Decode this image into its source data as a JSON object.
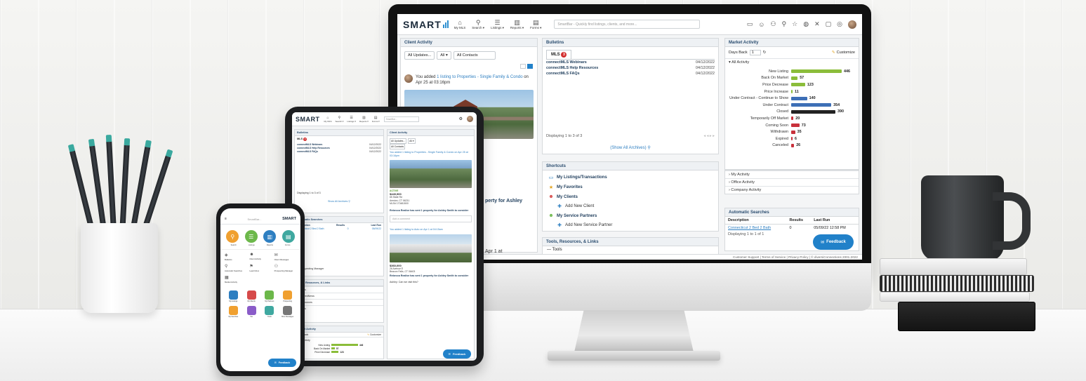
{
  "colors": {
    "accent": "#2181c9",
    "bar_green": "#8bbd3a",
    "bar_blue": "#3d6fb6",
    "bar_dark": "#222222",
    "bar_red": "#c8313b",
    "badge_red": "#d22e2e"
  },
  "desktop": {
    "logo": "SMART",
    "nav": [
      {
        "icon": "home-icon",
        "glyph": "⌂",
        "label": "My MLS"
      },
      {
        "icon": "search-icon",
        "glyph": "⚲",
        "label": "Search ▾"
      },
      {
        "icon": "listings-icon",
        "glyph": "☰",
        "label": "Listings ▾"
      },
      {
        "icon": "reports-icon",
        "glyph": "▥",
        "label": "Reports ▾"
      },
      {
        "icon": "forms-icon",
        "glyph": "▤",
        "label": "Forms ▾"
      }
    ],
    "smartbar_placeholder": "SmartBar - Quickly find listings, clients, and more...",
    "tool_icons": [
      "folder-icon",
      "contact-icon",
      "user-icon",
      "zoom-icon",
      "star-icon",
      "globe-icon",
      "settings-icon",
      "chat-icon",
      "help-icon"
    ],
    "client_activity": {
      "title": "Client Activity",
      "filter_updates": "All Updates...",
      "filter_all": "All ▾",
      "filter_contacts": "All Contacts",
      "activity_prefix": "You added ",
      "activity_link": "1 listing to Properties - Single Family & Condo",
      "activity_suffix": " on Apr 25 at 03:16pm",
      "partial_text_1": "perty for Ashley",
      "partial_text_2": "Apr 1 at"
    },
    "bulletins": {
      "title": "Bulletins",
      "tab_label": "MLS",
      "badge": "3",
      "items": [
        {
          "title": "connectMLS Webinars",
          "date": "04/12/2022"
        },
        {
          "title": "connectMLS Help Resources",
          "date": "04/12/2022"
        },
        {
          "title": "connectMLS FAQs",
          "date": "04/12/2022"
        }
      ],
      "displaying": "Displaying 1 to 3 of 3",
      "show_all": "(Show All Archives)"
    },
    "shortcuts": {
      "title": "Shortcuts",
      "items": [
        {
          "icon": "listings-folder-icon",
          "glyph": "▭",
          "label": "My Listings/Transactions",
          "sub": false
        },
        {
          "icon": "star-icon",
          "glyph": "★",
          "label": "My Favorites",
          "sub": false
        },
        {
          "icon": "clients-icon",
          "glyph": "☻",
          "label": "My Clients",
          "sub": false
        },
        {
          "icon": "plus-icon",
          "glyph": "✚",
          "label": "Add New Client",
          "sub": true
        },
        {
          "icon": "partners-icon",
          "glyph": "☻",
          "label": "My Service Partners",
          "sub": false
        },
        {
          "icon": "plus-icon",
          "glyph": "✚",
          "label": "Add New Service Partner",
          "sub": true
        }
      ]
    },
    "tools_panel": {
      "title": "Tools, Resources, & Links",
      "first_item": "Tools"
    },
    "market_activity": {
      "title": "Market Activity",
      "days_back_label": "Days Back",
      "days_back_value": "1",
      "customize": "Customize",
      "all_activity": "All Activity",
      "collapsed": [
        "My Activity",
        "Office Activity",
        "Company Activity"
      ]
    },
    "chart_data": {
      "type": "bar",
      "orientation": "horizontal",
      "categories": [
        "New Listing",
        "Back On Market",
        "Price Decrease",
        "Price Increase",
        "Under Contract - Continue to Show",
        "Under Contract",
        "Closed",
        "Temporarily Off Market",
        "Coming Soon",
        "Withdrawn",
        "Expired",
        "Canceled"
      ],
      "values": [
        446,
        57,
        123,
        11,
        140,
        354,
        390,
        20,
        73,
        35,
        6,
        26
      ],
      "colors": [
        "#8bbd3a",
        "#8bbd3a",
        "#8bbd3a",
        "#8bbd3a",
        "#3d6fb6",
        "#3d6fb6",
        "#222222",
        "#c8313b",
        "#c8313b",
        "#c8313b",
        "#c8313b",
        "#c8313b"
      ],
      "xlim": [
        0,
        446
      ],
      "grid": false,
      "legend": "none"
    },
    "automatic_searches": {
      "title": "Automatic Searches",
      "columns": [
        "Description",
        "Results",
        "Last Run"
      ],
      "rows": [
        [
          "Connecticut 2 Bed 2 Bath",
          "0",
          "05/09/22 12:58 PM"
        ]
      ],
      "displaying": "Displaying 1 to 1 of 1"
    },
    "feedback": "Feedback",
    "footer": "Customer Support | Terms of Service | Privacy Policy | © diversiConnections 2001-2022"
  },
  "tablet": {
    "logo": "SMART",
    "search_placeholder": "SmartBar...",
    "bulletins_title": "Bulletins",
    "bulletins_tab": "MLS",
    "bulletin_items": [
      {
        "title": "connectMLS Webinars",
        "date": "04/12/2022"
      },
      {
        "title": "connectMLS Help Resources",
        "date": "04/12/2022"
      },
      {
        "title": "connectMLS FAQs",
        "date": "04/12/2022"
      }
    ],
    "bulletins_displaying": "Displaying 1 to 3 of 3",
    "show_all": "Show All Archives",
    "auto_searches_title": "Automatic Searches",
    "prospecting_manager": "Prospecting Manager",
    "tools_title": "Tools, Resources, & Links",
    "tools_items": [
      "Tools",
      "MyFeedNews",
      "Resources",
      "Links"
    ],
    "market_title": "Market Activity",
    "days_back": "Days Back",
    "customize": "Customize",
    "all_activity": "All Activity",
    "mini_bars": [
      {
        "label": "New Listing",
        "value": 446
      },
      {
        "label": "Back On Market",
        "value": 57
      },
      {
        "label": "Price Decrease",
        "value": 123
      }
    ],
    "client_activity_title": "Client Activity",
    "filter_updates": "All Updates...",
    "filter_all": "All ▾",
    "filter_contacts": "All Contacts",
    "activity_1": "You added 1 listing to Properties - Single Family & Condo on Apr 25 at 03:16pm",
    "listing_1": {
      "price": "$449,900",
      "address": "65 State Rd",
      "city": "Amston, CT 06231",
      "mls": "MLS# 170481500",
      "status": "ACTIVE"
    },
    "rebecca_msg": "Rebecca Realtor has sent 1 property for Ashley Smith to consider",
    "comment_placeholder": "Add a comment",
    "activity_2": "You added 1 listing to Auto on Apr 1 at 04:15am",
    "listing_2": {
      "price": "$360,000",
      "address": "26 Avenue E",
      "city": "Beacon Falls, CT 06403",
      "mls": "MLS# 170470586",
      "status": "ACTIVE"
    },
    "rebecca_msg_2": "Rebecca Realtor has sent 1 property for Ashley Smith to consider",
    "ashley_msg": "Ashley: Can we visit this?",
    "feedback": "Feedback"
  },
  "phone": {
    "search_placeholder": "SmartBar...",
    "logo": "SMART",
    "circles": [
      {
        "label": "Search",
        "color": "#f0a030",
        "glyph": "⚲"
      },
      {
        "label": "Listings",
        "color": "#6cb84a",
        "glyph": "☰"
      },
      {
        "label": "Reports",
        "color": "#2e7fc1",
        "glyph": "▥"
      },
      {
        "label": "Forms",
        "color": "#3fa8a0",
        "glyph": "▤"
      }
    ],
    "grid": [
      {
        "icon": "bulletins-icon",
        "glyph": "◈",
        "label": "Bulletins"
      },
      {
        "icon": "client-activity-icon",
        "glyph": "☻",
        "label": "Client Activity"
      },
      {
        "icon": "client-messages-icon",
        "glyph": "✉",
        "label": "Client Messages"
      },
      {
        "icon": "auto-searches-icon",
        "glyph": "⚲",
        "label": "Automatic Searches"
      },
      {
        "icon": "lead-inbox-icon",
        "glyph": "⚑",
        "label": "Lead Inbox"
      },
      {
        "icon": "prospecting-icon",
        "glyph": "⚇",
        "label": "Prospecting Manager"
      },
      {
        "icon": "market-activity-icon",
        "glyph": "▦",
        "label": "Market Activity"
      }
    ],
    "apps": [
      {
        "label": "My Listings",
        "color": "#2e7fc1"
      },
      {
        "label": "My Clients",
        "color": "#d64a4a"
      },
      {
        "label": "My Partners",
        "color": "#6cb84a"
      },
      {
        "label": "Prospecting",
        "color": "#f0a030"
      },
      {
        "label": "My Favorites",
        "color": "#f0a030"
      },
      {
        "label": "Tax",
        "color": "#8a5cc8"
      },
      {
        "label": "Tools",
        "color": "#3fa8a0"
      },
      {
        "label": "More Messages",
        "color": "#777777"
      }
    ],
    "feedback": "Feedback"
  }
}
